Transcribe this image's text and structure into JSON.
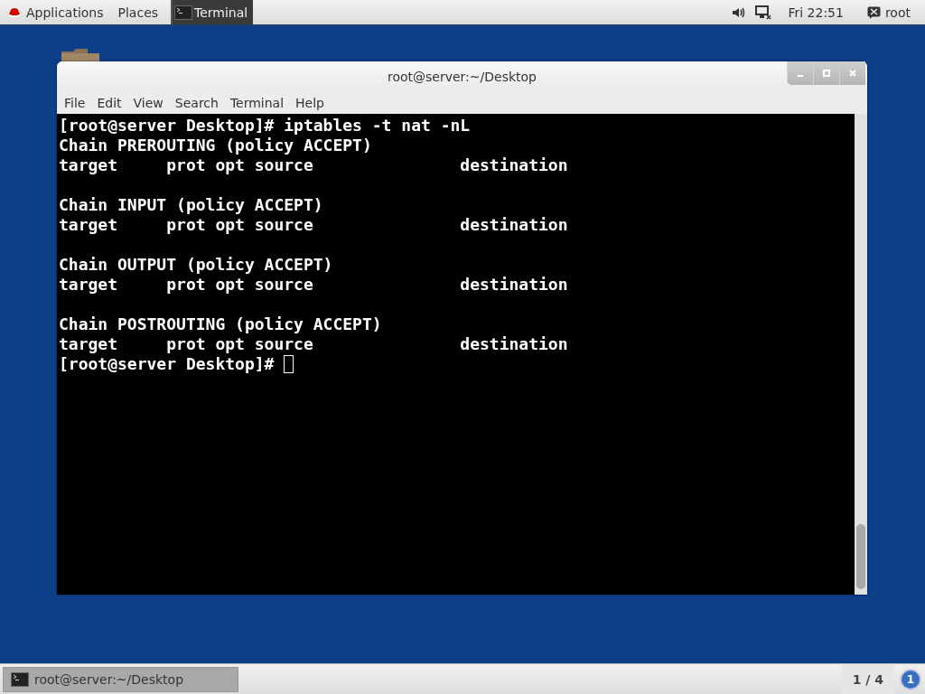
{
  "top_bar": {
    "applications": "Applications",
    "places": "Places",
    "task": {
      "label": "Terminal",
      "selected": true
    },
    "clock": "Fri 22:51",
    "user": "root"
  },
  "window": {
    "title": "root@server:~/Desktop",
    "menu": [
      "File",
      "Edit",
      "View",
      "Search",
      "Terminal",
      "Help"
    ]
  },
  "terminal": {
    "command": "[root@server Desktop]# iptables -t nat -nL",
    "chains": [
      {
        "header": "Chain PREROUTING (policy ACCEPT)",
        "columns": "target     prot opt source               destination"
      },
      {
        "header": "Chain INPUT (policy ACCEPT)",
        "columns": "target     prot opt source               destination"
      },
      {
        "header": "Chain OUTPUT (policy ACCEPT)",
        "columns": "target     prot opt source               destination"
      },
      {
        "header": "Chain POSTROUTING (policy ACCEPT)",
        "columns": "target     prot opt source               destination"
      }
    ],
    "prompt": "[root@server Desktop]#"
  },
  "taskbar": {
    "windows": [
      {
        "label": "root@server:~/Desktop",
        "selected": true
      }
    ],
    "workspace": "1 / 4",
    "notifications": "1"
  }
}
